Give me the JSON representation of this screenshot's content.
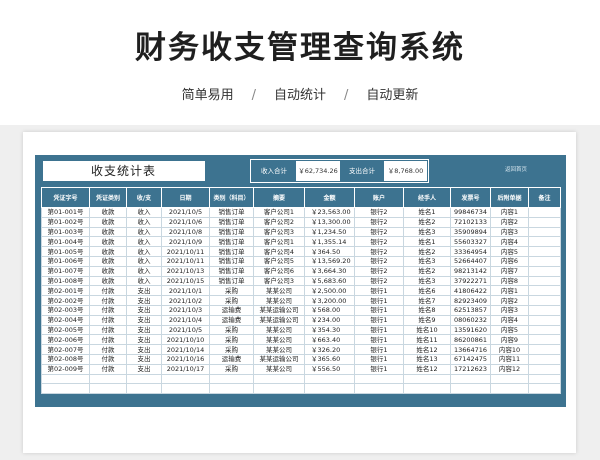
{
  "header": {
    "title": "财务收支管理查询系统",
    "features": [
      "简单易用",
      "自动统计",
      "自动更新"
    ],
    "separator": "/"
  },
  "panel": {
    "system_title": "收支统计表",
    "income_total_label": "收入合计",
    "income_total_value": "￥62,734.26",
    "expense_total_label": "支出合计",
    "expense_total_value": "￥8,768.00",
    "back_link": "返回首页"
  },
  "table": {
    "columns": [
      "凭证字号",
      "凭证类别",
      "收/支",
      "日期",
      "类别（科目）",
      "摘要",
      "金额",
      "账户",
      "经手人",
      "发票号",
      "后附单据",
      "备注"
    ],
    "rows": [
      [
        "第01-001号",
        "收款",
        "收入",
        "2021/10/5",
        "销售订单",
        "客户公司1",
        "￥23,563.00",
        "银行2",
        "姓名1",
        "99846734",
        "内容1",
        ""
      ],
      [
        "第01-002号",
        "收款",
        "收入",
        "2021/10/6",
        "销售订单",
        "客户公司2",
        "￥13,300.00",
        "银行2",
        "姓名2",
        "72102133",
        "内容2",
        ""
      ],
      [
        "第01-003号",
        "收款",
        "收入",
        "2021/10/8",
        "销售订单",
        "客户公司3",
        "￥1,234.50",
        "银行2",
        "姓名3",
        "35909894",
        "内容3",
        ""
      ],
      [
        "第01-004号",
        "收款",
        "收入",
        "2021/10/9",
        "销售订单",
        "客户公司1",
        "￥1,355.14",
        "银行2",
        "姓名1",
        "55603327",
        "内容4",
        ""
      ],
      [
        "第01-005号",
        "收款",
        "收入",
        "2021/10/11",
        "销售订单",
        "客户公司4",
        "￥364.50",
        "银行2",
        "姓名2",
        "33364954",
        "内容5",
        ""
      ],
      [
        "第01-006号",
        "收款",
        "收入",
        "2021/10/11",
        "销售订单",
        "客户公司5",
        "￥13,569.20",
        "银行2",
        "姓名3",
        "52664407",
        "内容6",
        ""
      ],
      [
        "第01-007号",
        "收款",
        "收入",
        "2021/10/13",
        "销售订单",
        "客户公司6",
        "￥3,664.30",
        "银行2",
        "姓名2",
        "98213142",
        "内容7",
        ""
      ],
      [
        "第01-008号",
        "收款",
        "收入",
        "2021/10/15",
        "销售订单",
        "客户公司3",
        "￥5,683.60",
        "银行2",
        "姓名3",
        "37922271",
        "内容8",
        ""
      ],
      [
        "第02-001号",
        "付款",
        "支出",
        "2021/10/1",
        "采购",
        "某某公司",
        "￥2,500.00",
        "银行1",
        "姓名6",
        "41806422",
        "内容1",
        ""
      ],
      [
        "第02-002号",
        "付款",
        "支出",
        "2021/10/2",
        "采购",
        "某某公司",
        "￥3,200.00",
        "银行1",
        "姓名7",
        "82923409",
        "内容2",
        ""
      ],
      [
        "第02-003号",
        "付款",
        "支出",
        "2021/10/3",
        "运输费",
        "某某运输公司",
        "￥568.00",
        "银行1",
        "姓名8",
        "62513857",
        "内容3",
        ""
      ],
      [
        "第02-004号",
        "付款",
        "支出",
        "2021/10/4",
        "运输费",
        "某某运输公司",
        "￥234.00",
        "银行1",
        "姓名9",
        "08060232",
        "内容4",
        ""
      ],
      [
        "第02-005号",
        "付款",
        "支出",
        "2021/10/5",
        "采购",
        "某某公司",
        "￥354.30",
        "银行1",
        "姓名10",
        "13591620",
        "内容5",
        ""
      ],
      [
        "第02-006号",
        "付款",
        "支出",
        "2021/10/10",
        "采购",
        "某某公司",
        "￥663.40",
        "银行1",
        "姓名11",
        "86200861",
        "内容9",
        ""
      ],
      [
        "第02-007号",
        "付款",
        "支出",
        "2021/10/14",
        "采购",
        "某某公司",
        "￥326.20",
        "银行1",
        "姓名12",
        "13664716",
        "内容10",
        ""
      ],
      [
        "第02-008号",
        "付款",
        "支出",
        "2021/10/16",
        "运输费",
        "某某运输公司",
        "￥365.60",
        "银行1",
        "姓名13",
        "67142475",
        "内容11",
        ""
      ],
      [
        "第02-009号",
        "付款",
        "支出",
        "2021/10/17",
        "采购",
        "某某公司",
        "￥556.50",
        "银行1",
        "姓名12",
        "17212623",
        "内容12",
        ""
      ],
      [
        "",
        "",
        "",
        "",
        "",
        "",
        "",
        "",
        "",
        "",
        "",
        ""
      ],
      [
        "",
        "",
        "",
        "",
        "",
        "",
        "",
        "",
        "",
        "",
        "",
        ""
      ]
    ]
  },
  "colors": {
    "accent": "#3d7390",
    "grid": "#c9d7e0"
  }
}
